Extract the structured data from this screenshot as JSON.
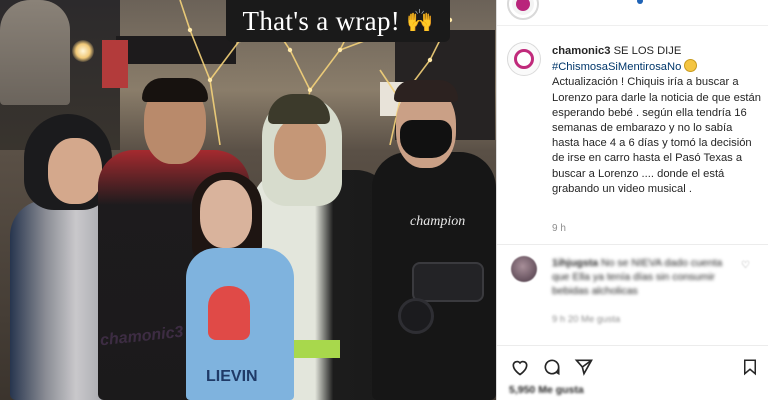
{
  "photo": {
    "banner_text": "That's a wrap!",
    "banner_emoji": "🙌",
    "girl_sweater_text": "LIEVIN",
    "shirt_logo_text": "champion",
    "watermark": "chamonic3"
  },
  "post": {
    "username": "chamonic3",
    "caption_lead": "SE LOS DIJE",
    "hashtag": "#ChismosaSiMentirosaNo",
    "caption_body": "Actualización ! Chiquis iría a buscar a Lorenzo para darle la noticia de que están esperando bebé . según ella tendría 16 semanas de embarazo y no lo sabía hasta hace 4 a 6 días y tomó la decisión de irse en carro hasta el Pasó Texas a buscar a Lorenzo .... donde el está grabando un video musical .",
    "timestamp": "9 h"
  },
  "comment": {
    "username": "1ihjugsta",
    "text": "No se NIEVA dado cuenta que Ella ya tenía días sin consumir bebidas alcholicas",
    "meta": "9 h   20 Me gusta"
  },
  "likes_text": "5,950 Me gusta",
  "icons": [
    "heart-icon",
    "comment-icon",
    "share-icon",
    "bookmark-icon"
  ],
  "colors": {
    "hashtag": "#00376b",
    "text": "#262626",
    "muted": "#8e8e8e",
    "story_ring": "#c02a7b"
  }
}
